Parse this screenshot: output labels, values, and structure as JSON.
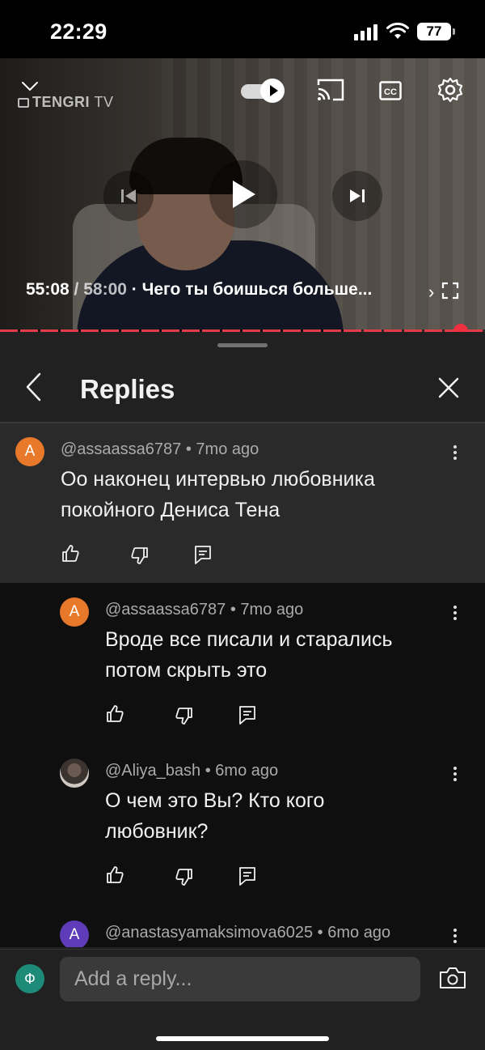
{
  "status_bar": {
    "time": "22:29",
    "battery": "77"
  },
  "player": {
    "channel_logo": "TENGRI",
    "channel_logo_suffix": "TV",
    "current_time": "55:08",
    "separator": " / ",
    "duration": "58:00",
    "title": "· Чего ты боишься больше...",
    "progress_fraction": 0.95,
    "accent_color": "#f0303f",
    "icons": [
      "chevron-down-icon",
      "autoplay-toggle",
      "cast-icon",
      "captions-icon",
      "settings-gear-icon",
      "previous-icon",
      "play-icon",
      "next-icon",
      "chevron-right-icon",
      "fullscreen-icon"
    ]
  },
  "sheet": {
    "title": "Replies"
  },
  "comments": [
    {
      "avatar_letter": "A",
      "avatar_color": "#e8792b",
      "author": "@assaassa6787",
      "age": "7mo ago",
      "text_lines": [
        "Оо наконец интервью любовника",
        "покойного Дениса Тена"
      ]
    },
    {
      "avatar_letter": "A",
      "avatar_color": "#e8792b",
      "author": "@assaassa6787",
      "age": "7mo ago",
      "text_lines": [
        "Вроде все писали и старались",
        "потом скрыть это"
      ]
    },
    {
      "avatar_letter": "",
      "avatar_color": "#3b3330",
      "author": "@Aliya_bash",
      "age": "6mo ago",
      "text_lines": [
        "О чем это Вы? Кто кого",
        "любовник?"
      ]
    },
    {
      "avatar_letter": "A",
      "avatar_color": "#5e3bb8",
      "author": "@anastasyamaksimova6025",
      "age": "6mo ago",
      "text_lines": []
    }
  ],
  "meta_separator": " • ",
  "reply_bar": {
    "me_avatar_letter": "Ф",
    "placeholder": "Add a reply..."
  }
}
